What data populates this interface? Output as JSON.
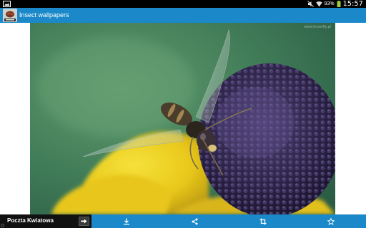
{
  "status_bar": {
    "battery_percent": "93%",
    "time": "15:57",
    "icons": [
      "picture-notification-icon",
      "mute-icon",
      "wifi-icon",
      "battery-icon"
    ]
  },
  "action_bar": {
    "title": "Insect wallpapers",
    "icon": "app-icon"
  },
  "wallpaper": {
    "watermark": "www.hoverfly.pl"
  },
  "bottom_toolbar": {
    "buttons": [
      {
        "icon": "download-icon"
      },
      {
        "icon": "share-icon"
      },
      {
        "icon": "crop-icon"
      },
      {
        "icon": "star-icon"
      }
    ]
  },
  "ad_banner": {
    "title": "Poczta Kwiatowa",
    "icon": "arrow-right-icon"
  },
  "colors": {
    "action_bar": "#1a88c9",
    "status_bar": "#000000",
    "ad_banner": "#111111"
  }
}
